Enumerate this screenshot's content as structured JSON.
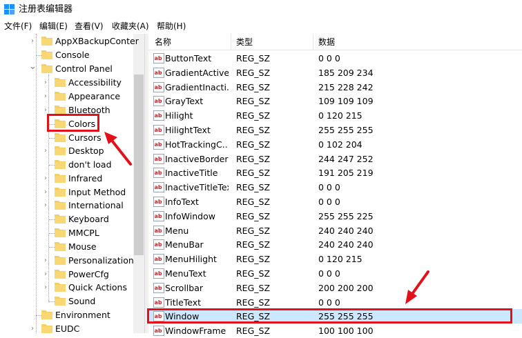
{
  "window": {
    "title": "注册表编辑器",
    "icon": "regedit-icon"
  },
  "menu": [
    {
      "label": "文件(F)"
    },
    {
      "label": "编辑(E)"
    },
    {
      "label": "查看(V)"
    },
    {
      "label": "收藏夹(A)"
    },
    {
      "label": "帮助(H)"
    }
  ],
  "tree": {
    "items": [
      {
        "label": "AppXBackupConter",
        "expander": "collapsed"
      },
      {
        "label": "Console",
        "expander": "none"
      },
      {
        "label": "Control Panel",
        "expander": "expanded"
      },
      {
        "label": "Accessibility",
        "expander": "collapsed"
      },
      {
        "label": "Appearance",
        "expander": "collapsed"
      },
      {
        "label": "Bluetooth",
        "expander": "collapsed"
      },
      {
        "label": "Colors",
        "expander": "none",
        "selected": true
      },
      {
        "label": "Cursors",
        "expander": "none"
      },
      {
        "label": "Desktop",
        "expander": "collapsed"
      },
      {
        "label": "don't load",
        "expander": "none"
      },
      {
        "label": "Infrared",
        "expander": "collapsed"
      },
      {
        "label": "Input Method",
        "expander": "collapsed"
      },
      {
        "label": "International",
        "expander": "collapsed"
      },
      {
        "label": "Keyboard",
        "expander": "none"
      },
      {
        "label": "MMCPL",
        "expander": "none"
      },
      {
        "label": "Mouse",
        "expander": "none"
      },
      {
        "label": "Personalization",
        "expander": "collapsed"
      },
      {
        "label": "PowerCfg",
        "expander": "collapsed"
      },
      {
        "label": "Quick Actions",
        "expander": "collapsed"
      },
      {
        "label": "Sound",
        "expander": "none"
      },
      {
        "label": "Environment",
        "expander": "none"
      },
      {
        "label": "EUDC",
        "expander": "collapsed"
      }
    ]
  },
  "list": {
    "headers": {
      "name": "名称",
      "type": "类型",
      "data": "数据"
    },
    "rows": [
      {
        "name": "ButtonText",
        "type": "REG_SZ",
        "data": "0 0 0"
      },
      {
        "name": "GradientActive...",
        "type": "REG_SZ",
        "data": "185 209 234"
      },
      {
        "name": "GradientInacti...",
        "type": "REG_SZ",
        "data": "215 228 242"
      },
      {
        "name": "GrayText",
        "type": "REG_SZ",
        "data": "109 109 109"
      },
      {
        "name": "Hilight",
        "type": "REG_SZ",
        "data": "0 120 215"
      },
      {
        "name": "HilightText",
        "type": "REG_SZ",
        "data": "255 255 255"
      },
      {
        "name": "HotTrackingC...",
        "type": "REG_SZ",
        "data": "0 102 204"
      },
      {
        "name": "InactiveBorder",
        "type": "REG_SZ",
        "data": "244 247 252"
      },
      {
        "name": "InactiveTitle",
        "type": "REG_SZ",
        "data": "191 205 219"
      },
      {
        "name": "InactiveTitleText",
        "type": "REG_SZ",
        "data": "0 0 0"
      },
      {
        "name": "InfoText",
        "type": "REG_SZ",
        "data": "0 0 0"
      },
      {
        "name": "InfoWindow",
        "type": "REG_SZ",
        "data": "255 255 225"
      },
      {
        "name": "Menu",
        "type": "REG_SZ",
        "data": "240 240 240"
      },
      {
        "name": "MenuBar",
        "type": "REG_SZ",
        "data": "240 240 240"
      },
      {
        "name": "MenuHilight",
        "type": "REG_SZ",
        "data": "0 120 215"
      },
      {
        "name": "MenuText",
        "type": "REG_SZ",
        "data": "0 0 0"
      },
      {
        "name": "Scrollbar",
        "type": "REG_SZ",
        "data": "200 200 200"
      },
      {
        "name": "TitleText",
        "type": "REG_SZ",
        "data": "0 0 0"
      },
      {
        "name": "Window",
        "type": "REG_SZ",
        "data": "255 255 255",
        "selected": true
      },
      {
        "name": "WindowFrame",
        "type": "REG_SZ",
        "data": "100 100 100"
      }
    ]
  },
  "colors": {
    "annotation_red": "#e3101a",
    "selection": "#cce8ff",
    "folder": "#f6cf63"
  }
}
